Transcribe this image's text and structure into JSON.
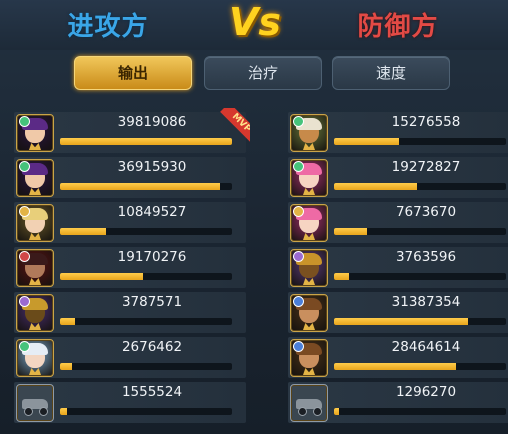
{
  "header": {
    "attacker_title": "进攻方",
    "vs_label": "Vs",
    "defender_title": "防御方"
  },
  "tabs": [
    {
      "label": "输出",
      "active": true
    },
    {
      "label": "治疗",
      "active": false
    },
    {
      "label": "速度",
      "active": false
    }
  ],
  "mvp_label": "MVP",
  "attackers": [
    {
      "value": "39819086",
      "fill": 1.0,
      "avatar": "purple-hair-warrior",
      "badge_color": "#46c37b",
      "mvp": true
    },
    {
      "value": "36915930",
      "fill": 0.93,
      "avatar": "purple-hair-warrior",
      "badge_color": "#46c37b"
    },
    {
      "value": "10849527",
      "fill": 0.27,
      "avatar": "blonde-hero",
      "badge_color": "#e3b446"
    },
    {
      "value": "19170276",
      "fill": 0.48,
      "avatar": "dark-hooded-hero",
      "badge_color": "#d14848"
    },
    {
      "value": "3787571",
      "fill": 0.09,
      "avatar": "golden-armored-hero",
      "badge_color": "#9b6ad0"
    },
    {
      "value": "2676462",
      "fill": 0.07,
      "avatar": "white-haired-mage",
      "badge_color": "#46c37b"
    },
    {
      "value": "1555524",
      "fill": 0.04,
      "avatar": "armored-vehicle",
      "badge_color": ""
    }
  ],
  "defenders": [
    {
      "value": "15276558",
      "fill": 0.38,
      "avatar": "monkey-king",
      "badge_color": "#46c37b"
    },
    {
      "value": "19272827",
      "fill": 0.48,
      "avatar": "pink-hair-archer",
      "badge_color": "#46c37b"
    },
    {
      "value": "7673670",
      "fill": 0.19,
      "avatar": "pink-hair-archer",
      "badge_color": "#e3b446"
    },
    {
      "value": "3763596",
      "fill": 0.09,
      "avatar": "golden-beast",
      "badge_color": "#9b6ad0"
    },
    {
      "value": "31387354",
      "fill": 0.78,
      "avatar": "bearded-warrior",
      "badge_color": "#4b7fd8"
    },
    {
      "value": "28464614",
      "fill": 0.71,
      "avatar": "bearded-warrior",
      "badge_color": "#4b7fd8"
    },
    {
      "value": "1296270",
      "fill": 0.03,
      "avatar": "armored-vehicle",
      "badge_color": ""
    }
  ],
  "colors": {
    "accent": "#e8a51c",
    "attacker": "#3aa6e8",
    "defender": "#e34a45",
    "vs": "#ffd21f"
  }
}
